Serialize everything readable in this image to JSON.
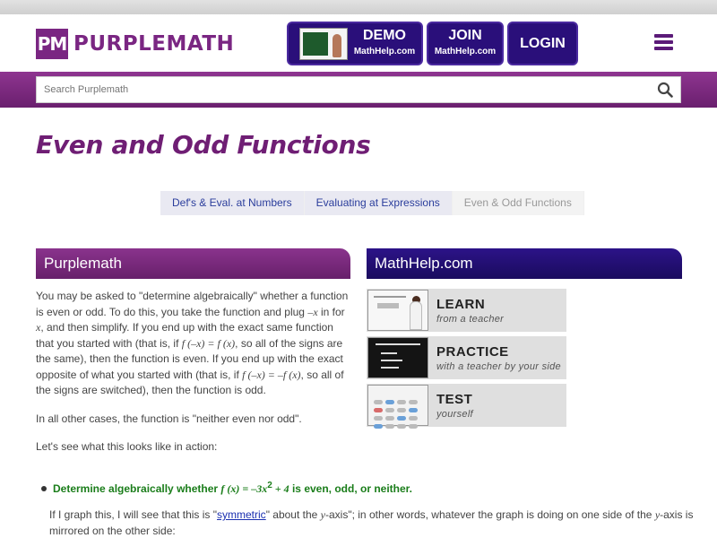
{
  "header": {
    "logo_mark": "PM",
    "logo_text": "PURPLEMATH",
    "demo": {
      "label": "DEMO",
      "sub": "MathHelp.com"
    },
    "join": {
      "label": "JOIN",
      "sub": "MathHelp.com"
    },
    "login": {
      "label": "LOGIN"
    }
  },
  "search": {
    "placeholder": "Search Purplemath"
  },
  "page_title": "Even and Odd Functions",
  "tabs": [
    {
      "label": "Def's & Eval. at Numbers",
      "active": false
    },
    {
      "label": "Evaluating at Expressions",
      "active": false
    },
    {
      "label": "Even & Odd Functions",
      "active": true
    }
  ],
  "left_card": {
    "title": "Purplemath"
  },
  "right_card": {
    "title": "MathHelp.com"
  },
  "content": {
    "p1": {
      "a": "You may be asked to \"determine algebraically\" whether a function is even or odd. To do this, you take the function and plug ",
      "v1": "–x",
      "b": " in for ",
      "v2": "x",
      "c": ", and then simplify. If you end up with the exact same function that you started with (that is, if ",
      "e1": "f (–x) = f (x)",
      "d": ", so all of the signs are the same), then the function is even. If you end up with the exact opposite of what you started with (that is, if ",
      "e2": "f (–x) = –f (x)",
      "e": ", so all of the signs are switched), then the function is odd."
    },
    "p2": "In all other cases, the function is \"neither even nor odd\".",
    "p3": "Let's see what this looks like in action:"
  },
  "promos": [
    {
      "main": "LEARN",
      "sub": "from a teacher"
    },
    {
      "main": "PRACTICE",
      "sub": "with a teacher by your side"
    },
    {
      "main": "TEST",
      "sub": "yourself"
    }
  ],
  "example": {
    "a": "Determine algebraically whether ",
    "expr": "f (x) = –3x",
    "exp": "2",
    "expr2": " + 4",
    "b": " is even, odd, or neither."
  },
  "followup": {
    "a": "If I graph this, I will see that this is \"",
    "link": "symmetric",
    "b": "\" about the ",
    "v1": "y",
    "c": "-axis\"; in other words, whatever the graph is doing on one side of the ",
    "v2": "y",
    "d": "-axis is mirrored on the other side:"
  },
  "colors": {
    "brand_purple": "#7a2682",
    "nav_blue": "#2a0f7a",
    "example_green": "#1a7d1a"
  }
}
